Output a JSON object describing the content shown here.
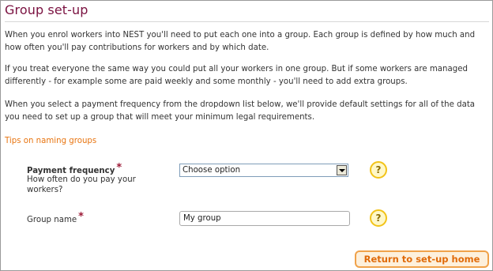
{
  "page": {
    "title": "Group set-up"
  },
  "intro": {
    "paragraph_1": "When you enrol workers into NEST you'll need to put each one into a group. Each group is defined by how much and how often you'll pay contributions for workers and by which date.",
    "paragraph_2": "If you treat everyone the same way you could put all your workers in one group. But if some workers are managed differently - for example some are paid weekly and some monthly - you'll need to add extra groups.",
    "paragraph_3": "When you select a payment frequency from the dropdown list below, we'll provide default settings for all of the data you need to set up a group that will meet your minimum legal requirements."
  },
  "tips_link": "Tips on naming groups",
  "form": {
    "payment_frequency": {
      "label": "Payment frequency",
      "required_mark": "*",
      "hint": "How often do you pay your workers?",
      "selected_value": "Choose option",
      "help_icon": "?"
    },
    "group_name": {
      "label": "Group name",
      "required_mark": "*",
      "value": "My group",
      "help_icon": "?"
    }
  },
  "actions": {
    "return_label": "Return to set-up home"
  },
  "colors": {
    "title": "#7a1140",
    "link": "#e87511",
    "required": "#9c1a37",
    "button_border": "#f0a24a",
    "button_text": "#e06a09",
    "help_border": "#f2c318"
  },
  "icons": {
    "dropdown": "chevron-down-icon",
    "help": "help-icon"
  }
}
